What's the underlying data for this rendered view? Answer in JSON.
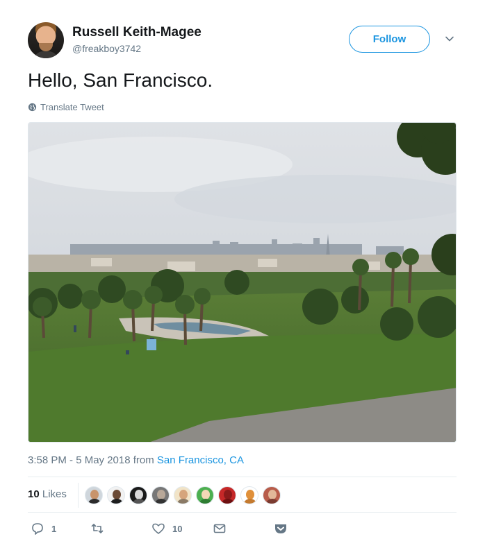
{
  "author": {
    "name": "Russell Keith-Magee",
    "handle": "@freakboy3742"
  },
  "follow_label": "Follow",
  "tweet": {
    "text": "Hello, San Francisco.",
    "translate_label": "Translate Tweet",
    "time_date": "3:58 PM - 5 May 2018 from ",
    "location": "San Francisco, CA"
  },
  "stats": {
    "likes_count": "10",
    "likes_label": " Likes"
  },
  "likers": [
    "avatar",
    "avatar",
    "avatar",
    "avatar",
    "avatar",
    "avatar",
    "avatar",
    "avatar",
    "avatar"
  ],
  "actions": {
    "reply_count": "1",
    "like_count": "10"
  },
  "colors": {
    "accent": "#1b95e0",
    "secondary_text": "#657786",
    "primary_text": "#14171a"
  },
  "icons": [
    "chevron-down-icon",
    "globe-icon",
    "reply-icon",
    "retweet-icon",
    "heart-icon",
    "mail-icon",
    "pocket-icon"
  ]
}
